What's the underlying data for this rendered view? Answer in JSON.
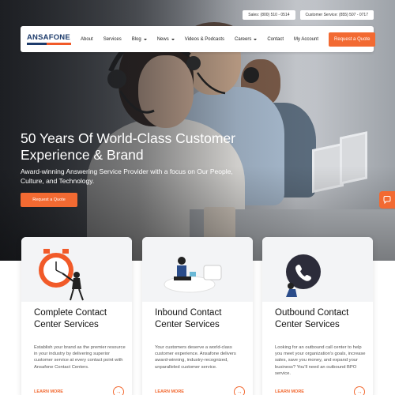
{
  "topbar": {
    "sales": "Sales: (800) 510 - 0514",
    "service": "Customer Service: (855) 507 - 0717"
  },
  "logo": {
    "text": "ANSAFONE"
  },
  "nav": {
    "items": [
      {
        "label": "About",
        "dropdown": false
      },
      {
        "label": "Services",
        "dropdown": false
      },
      {
        "label": "Blog",
        "dropdown": true
      },
      {
        "label": "News",
        "dropdown": true
      },
      {
        "label": "Videos & Podcasts",
        "dropdown": false
      },
      {
        "label": "Careers",
        "dropdown": true
      },
      {
        "label": "Contact",
        "dropdown": false
      },
      {
        "label": "My Account",
        "dropdown": false
      }
    ],
    "cta": "Request a Quote"
  },
  "hero": {
    "title": "50 Years Of World-Class Customer Experience & Brand",
    "subtitle": "Award-winning Answering Service Provider with a focus on Our People, Culture, and Technology.",
    "button": "Request a Quote"
  },
  "cards": [
    {
      "title": "Complete Contact Center Services",
      "desc": "Establish your brand as the premier resource in your industry by delivering superior customer service at every contact point with Ansafone Contact Centers.",
      "more": "LEARN MORE"
    },
    {
      "title": "Inbound Contact Center Services",
      "desc": "Your customers deserve a world-class customer experience. Ansafone delivers award-winning, industry-recognized, unparalleled customer service.",
      "more": "LEARN MORE"
    },
    {
      "title": "Outbound Contact Center Services",
      "desc": "Looking for an outbound call center to help you meet your organization's goals, increase sales, save you money, and expand your business? You'll need an outbound BPO service.",
      "more": "LEARN MORE"
    }
  ],
  "colors": {
    "accent": "#f26a32",
    "brand": "#1d3b6b"
  }
}
